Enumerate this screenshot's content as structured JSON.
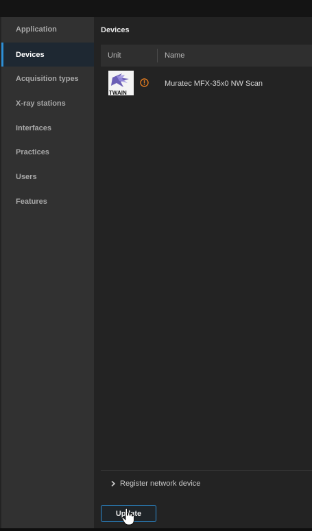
{
  "sidebar": {
    "items": [
      {
        "label": "Application"
      },
      {
        "label": "Devices"
      },
      {
        "label": "Acquisition types"
      },
      {
        "label": "X-ray stations"
      },
      {
        "label": "Interfaces"
      },
      {
        "label": "Practices"
      },
      {
        "label": "Users"
      },
      {
        "label": "Features"
      }
    ],
    "active_item": "Devices"
  },
  "main": {
    "title": "Devices",
    "table": {
      "columns": [
        "Unit",
        "Name"
      ],
      "rows": [
        {
          "unit_icon": "twain-logo",
          "status_icon": "warning-icon",
          "name": "Muratec MFX-35x0 NW Scan"
        }
      ]
    },
    "register_label": "Register network device",
    "update_label": "Update"
  },
  "colors": {
    "accent": "#2d8fd6",
    "warning": "#e07a1f",
    "sidebar_bg": "#313131",
    "main_bg": "#232323"
  },
  "icons": {
    "register": "chevron-right-icon",
    "pointer": "hand-cursor-icon"
  }
}
